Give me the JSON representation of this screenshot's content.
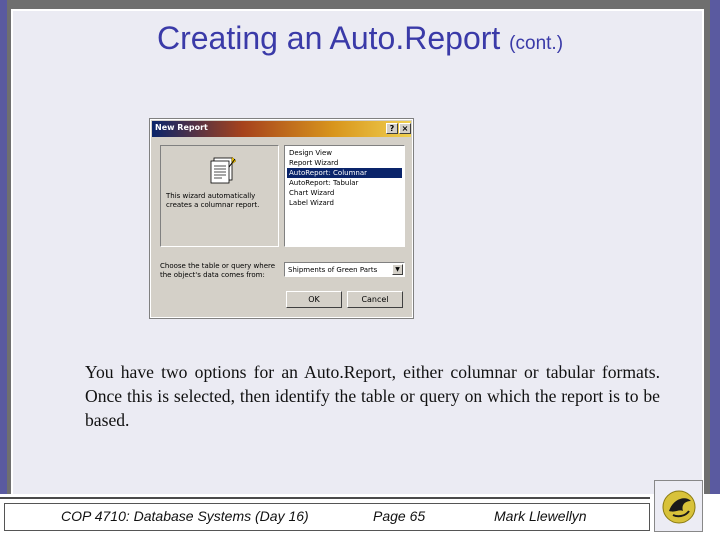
{
  "slide": {
    "title_main": "Creating an Auto.Report",
    "title_small": "(cont.)",
    "body": "You have two options for an Auto.Report, either columnar or tabular formats.  Once this is selected, then identify the table or query on which the report is to be based."
  },
  "dialog": {
    "title": "New Report",
    "help_label": "?",
    "close_label": "×",
    "description": "This wizard automatically creates a columnar report.",
    "wizard_items": [
      {
        "label": "Design View"
      },
      {
        "label": "Report Wizard"
      },
      {
        "label": "AutoReport: Columnar"
      },
      {
        "label": "AutoReport: Tabular"
      },
      {
        "label": "Chart Wizard"
      },
      {
        "label": "Label Wizard"
      }
    ],
    "selected_item": "AutoReport: Columnar",
    "prompt": "Choose the table or query where the object's data comes from:",
    "table_value": "Shipments of Green Parts",
    "ok_label": "OK",
    "cancel_label": "Cancel"
  },
  "footer": {
    "course": "COP 4710: Database Systems  (Day 16)",
    "page": "Page 65",
    "author": "Mark Llewellyn"
  },
  "colors": {
    "title": "#3a3aa8",
    "frame_accent": "#5a5aa0",
    "selection": "#0a246a",
    "dialog_face": "#d4d0c8"
  },
  "icons": [
    "report-wizard-icon",
    "dropdown-arrow-icon",
    "ucf-pegasus-logo-icon"
  ]
}
